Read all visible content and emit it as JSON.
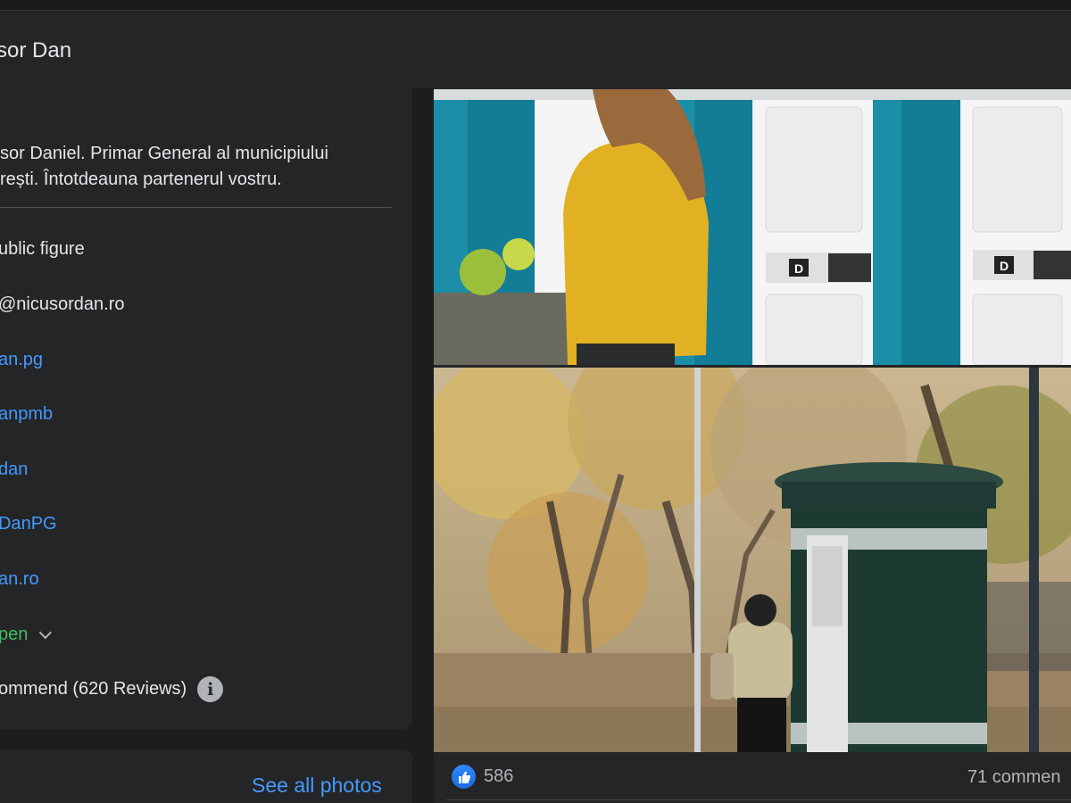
{
  "page": {
    "name": "sor Dan"
  },
  "intro": {
    "bio_line1": "sor Daniel. Primar General al municipiului",
    "bio_line2": "rești. Întotdeauna partenerul vostru.",
    "category": "ublic figure",
    "email": "@nicusordan.ro",
    "links": [
      "an.pg",
      "anpmb",
      "dan",
      "DanPG",
      "an.ro"
    ],
    "hours_status": "pen",
    "rating": "ommend (620 Reviews)",
    "info_glyph": "i"
  },
  "photos": {
    "see_all_label": "See all photos"
  },
  "post": {
    "reaction_count": "586",
    "comments_label": "71 commen",
    "toilet_label_1": "D",
    "toilet_label_2": "D"
  },
  "colors": {
    "link": "#4599ff",
    "open_status": "#45bd62",
    "card_bg": "#242526",
    "page_bg": "#1c1d1f",
    "like_blue": "#2d88ff"
  }
}
